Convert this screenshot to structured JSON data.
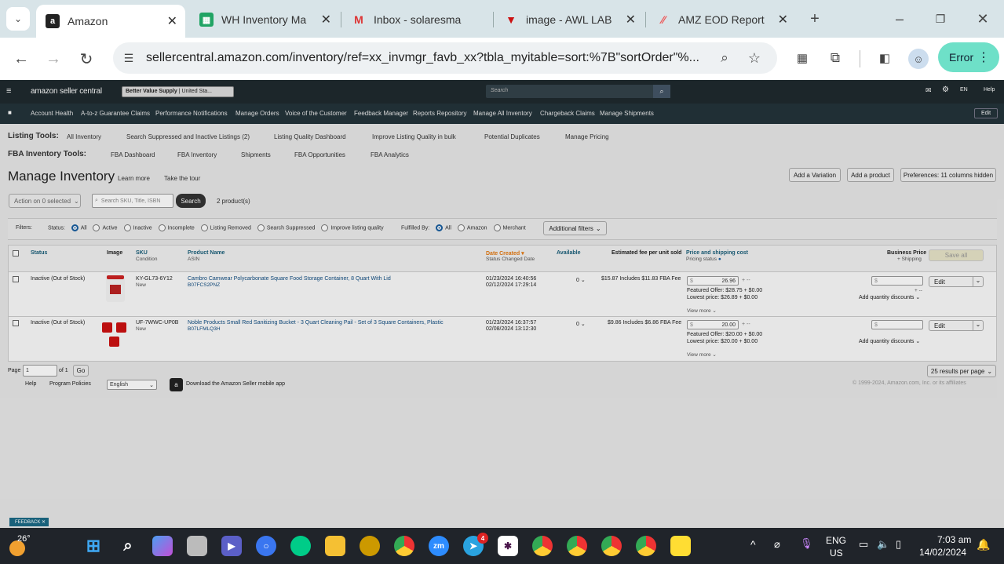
{
  "browser": {
    "tabs": [
      {
        "title": "Amazon",
        "icon": "amazon-icon",
        "active": true
      },
      {
        "title": "WH Inventory Ma",
        "icon": "sheets-icon",
        "active": false
      },
      {
        "title": "Inbox - solaresma",
        "icon": "gmail-icon",
        "active": false
      },
      {
        "title": "image - AWL LAB",
        "icon": "awl-icon",
        "active": false
      },
      {
        "title": "AMZ EOD Report",
        "icon": "clickup-icon",
        "active": false
      }
    ],
    "url": "sellercentral.amazon.com/inventory/ref=xx_invmgr_favb_xx?tbla_myitable=sort:%7B\"sortOrder\"%...",
    "profile_status": "Error"
  },
  "seller": {
    "logo": "amazon seller central",
    "store": "Better Value Supply",
    "marketplace": "| United Sta...",
    "search_placeholder": "Search",
    "lang": "EN",
    "help": "Help",
    "nav": [
      "Account Health",
      "A-to-z Guarantee Claims",
      "Performance Notifications",
      "Manage Orders",
      "Voice of the Customer",
      "Feedback Manager",
      "Reports Repository",
      "Manage All Inventory",
      "Chargeback Claims",
      "Manage Shipments"
    ],
    "edit": "Edit"
  },
  "tools": {
    "listing_label": "Listing Tools:",
    "listing": [
      "All Inventory",
      "Search Suppressed and Inactive Listings (2)",
      "Listing Quality Dashboard",
      "Improve Listing Quality in bulk",
      "Potential Duplicates",
      "Manage Pricing"
    ],
    "fba_label": "FBA Inventory Tools:",
    "fba": [
      "FBA Dashboard",
      "FBA Inventory",
      "Shipments",
      "FBA Opportunities",
      "FBA Analytics"
    ]
  },
  "page": {
    "title": "Manage Inventory",
    "learn_more": "Learn more",
    "tour": "Take the tour",
    "add_variation": "Add a Variation",
    "add_product": "Add a product",
    "preferences": "Preferences: 11 columns hidden",
    "action": "Action on 0 selected",
    "search_placeholder": "Search SKU, Title, ISBN",
    "search_btn": "Search",
    "count": "2 product(s)"
  },
  "filters": {
    "label": "Filters:",
    "status_label": "Status:",
    "status": [
      "All",
      "Active",
      "Inactive",
      "Incomplete",
      "Listing Removed",
      "Search Suppressed",
      "Improve listing quality"
    ],
    "fulfilled_label": "Fulfilled By:",
    "fulfilled": [
      "All",
      "Amazon",
      "Merchant"
    ],
    "additional": "Additional filters"
  },
  "table": {
    "headers": {
      "status": "Status",
      "image": "Image",
      "sku": "SKU",
      "condition": "Condition",
      "name": "Product Name",
      "asin": "ASIN",
      "date": "Date Created",
      "date_sub": "Status Changed Date",
      "available": "Available",
      "fee": "Estimated fee per unit sold",
      "price": "Price and shipping cost",
      "price_sub": "Pricing status",
      "business": "Business Price",
      "business_sub": "+ Shipping",
      "save_all": "Save all"
    },
    "rows": [
      {
        "status": "Inactive (Out of Stock)",
        "sku": "KY-GL73-6Y12",
        "condition": "New",
        "name": "Cambro Camwear Polycarbonate Square Food Storage Container, 8 Quart With Lid",
        "asin": "B07FCS2PNZ",
        "created": "01/23/2024 16:40:56",
        "changed": "02/12/2024 17:29:14",
        "available": "0",
        "fee": "$15.87 Includes $11.83 FBA Fee",
        "price": "26.96",
        "featured": "Featured Offer: $28.75 + $0.00",
        "lowest": "Lowest price: $26.89 + $0.00",
        "view_more": "View more",
        "qty_discounts": "Add quantity discounts",
        "edit": "Edit"
      },
      {
        "status": "Inactive (Out of Stock)",
        "sku": "UF-7WWC-UP0B",
        "condition": "New",
        "name": "Noble Products Small Red Sanitizing Bucket - 3 Quart Cleaning Pail - Set of 3 Square Containers, Plastic",
        "asin": "B07LFMLQ3H",
        "created": "01/23/2024 16:37:57",
        "changed": "02/08/2024 13:12:30",
        "available": "0",
        "fee": "$9.86 Includes $6.86 FBA Fee",
        "price": "20.00",
        "featured": "Featured Offer: $20.00 + $0.00",
        "lowest": "Lowest price: $20.00 + $0.00",
        "view_more": "View more",
        "qty_discounts": "Add quantity discounts",
        "edit": "Edit"
      }
    ]
  },
  "pagination": {
    "page_label": "Page",
    "page": "1",
    "of": "of 1",
    "go": "Go",
    "per_page": "25 results per page"
  },
  "footer": {
    "help": "Help",
    "policies": "Program Policies",
    "language": "English",
    "app": "Download the Amazon Seller mobile app",
    "copyright": "© 1999-2024, Amazon.com, Inc. or its affiliates"
  },
  "feedback": "FEEDBACK",
  "taskbar": {
    "temp": "26°",
    "lang1": "ENG",
    "lang2": "US",
    "time": "7:03 am",
    "date": "14/02/2024",
    "telegram_badge": "4"
  }
}
